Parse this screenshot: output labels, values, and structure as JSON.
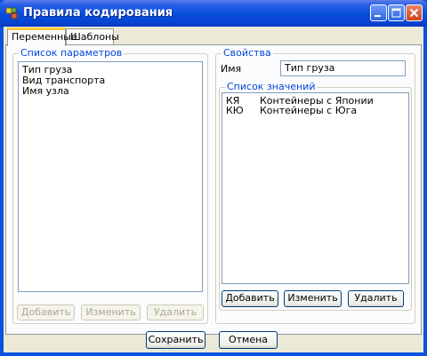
{
  "window": {
    "title": "Правила кодирования"
  },
  "tabs": [
    {
      "label": "Переменные",
      "active": true
    },
    {
      "label": "Шаблоны",
      "active": false
    }
  ],
  "params": {
    "legend": "Список параметров",
    "items": [
      "Тип груза",
      "Вид транспорта",
      "Имя узла"
    ],
    "buttons": {
      "add": "Добавить",
      "edit": "Изменить",
      "delete": "Удалить"
    }
  },
  "props": {
    "legend": "Свойства",
    "name_label": "Имя",
    "name_value": "Тип груза",
    "values_legend": "Список значений",
    "values": [
      {
        "code": "КЯ",
        "text": "Контейнеры с Японии"
      },
      {
        "code": "КЮ",
        "text": "Контейнеры с Юга"
      }
    ],
    "buttons": {
      "add": "Добавить",
      "edit": "Изменить",
      "delete": "Удалить"
    }
  },
  "footer": {
    "save": "Сохранить",
    "cancel": "Отмена"
  },
  "colors": {
    "title_bar": "#0a4fdc",
    "tab_highlight": "#ffc83c",
    "group_legend": "#0046d5",
    "face": "#ece9d8"
  }
}
